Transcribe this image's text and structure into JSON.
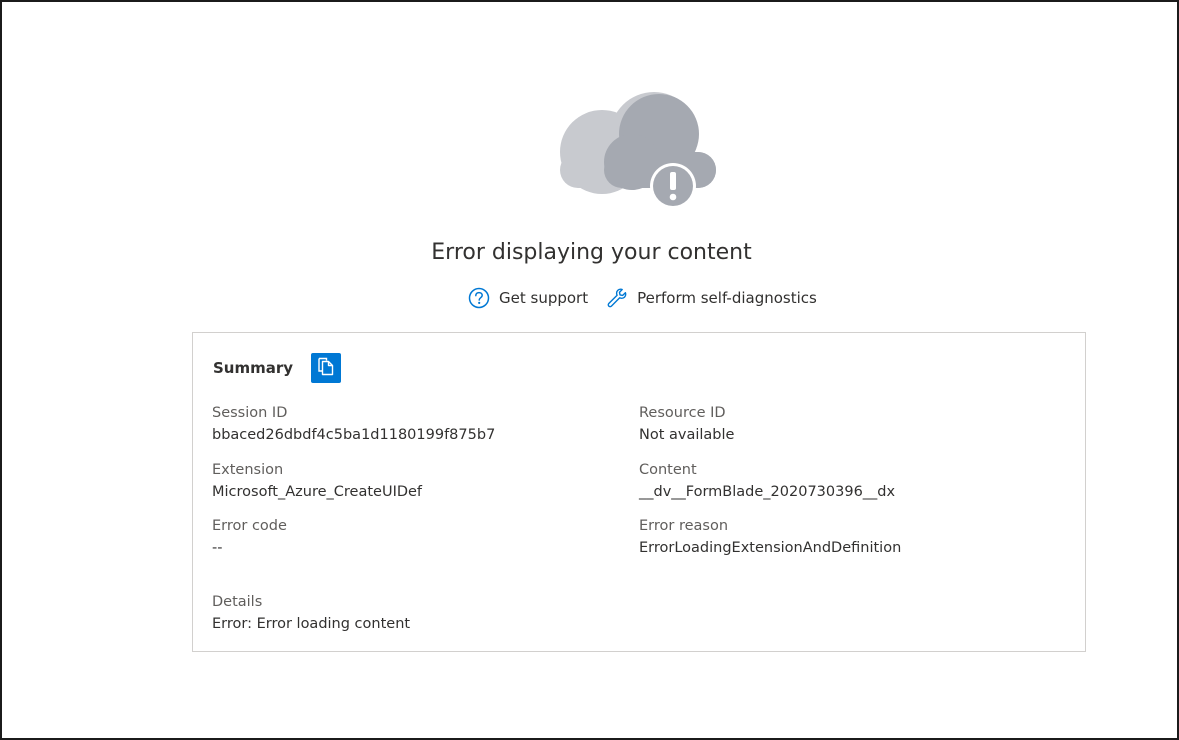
{
  "error": {
    "title": "Error displaying your content"
  },
  "actions": {
    "get_support": "Get support",
    "self_diagnostics": "Perform self-diagnostics"
  },
  "icons": {
    "cloud": "cloud-error-icon",
    "help": "question-circle-icon",
    "wrench": "wrench-icon",
    "copy": "copy-icon"
  },
  "colors": {
    "accent": "#0078d4",
    "cloud_light": "#c8cacf",
    "cloud_dark": "#a5a9b1"
  },
  "summary": {
    "title": "Summary",
    "session_id": {
      "label": "Session ID",
      "value": "bbaced26dbdf4c5ba1d1180199f875b7"
    },
    "resource_id": {
      "label": "Resource ID",
      "value": "Not available"
    },
    "extension": {
      "label": "Extension",
      "value": "Microsoft_Azure_CreateUIDef"
    },
    "content": {
      "label": "Content",
      "value": "__dv__FormBlade_2020730396__dx"
    },
    "error_code": {
      "label": "Error code",
      "value": "--"
    },
    "error_reason": {
      "label": "Error reason",
      "value": "ErrorLoadingExtensionAndDefinition"
    },
    "details": {
      "label": "Details",
      "value": "Error: Error loading content"
    }
  }
}
